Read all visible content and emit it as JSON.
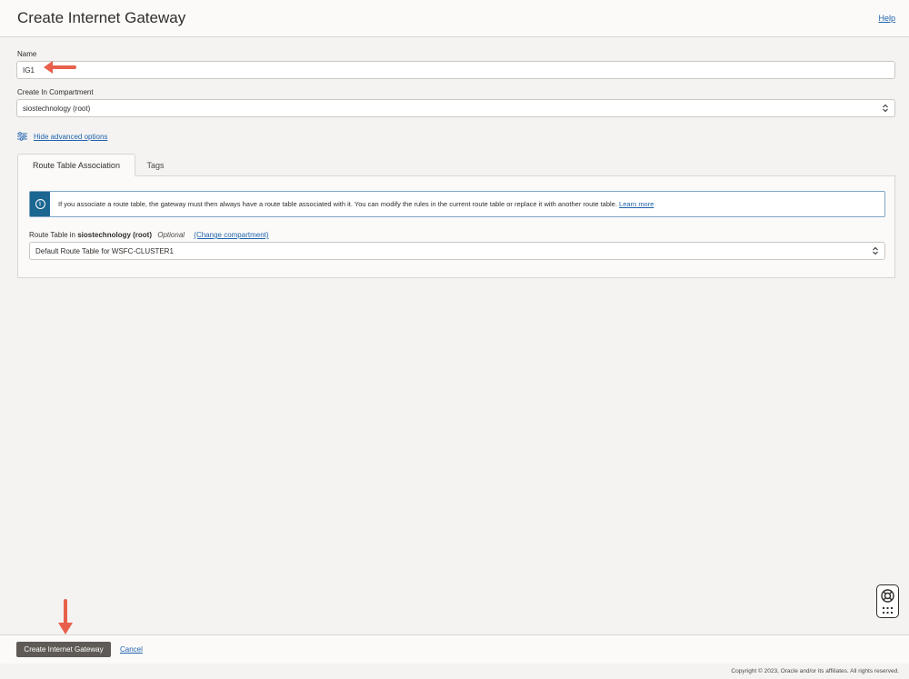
{
  "header": {
    "title": "Create Internet Gateway",
    "help_label": "Help"
  },
  "form": {
    "name_label": "Name",
    "name_value": "IG1",
    "compartment_label": "Create In Compartment",
    "compartment_value": "siostechnology (root)",
    "advanced_toggle_label": "Hide advanced options"
  },
  "tabs": [
    {
      "label": "Route Table Association",
      "active": true
    },
    {
      "label": "Tags",
      "active": false
    }
  ],
  "route_table": {
    "info_text": "If you associate a route table, the gateway must then always have a route table associated with it. You can modify the rules in the current route table or replace it with another route table.",
    "info_link": "Learn more",
    "label_prefix": "Route Table in",
    "compartment": "siostechnology (root)",
    "optional": "Optional",
    "change_compartment": "(Change compartment)",
    "selected": "Default Route Table for WSFC-CLUSTER1"
  },
  "footer": {
    "create_button": "Create Internet Gateway",
    "cancel_label": "Cancel",
    "copyright": "Copyright © 2023, Oracle and/or its affiliates. All rights reserved."
  },
  "annotation_color": "#e8604c",
  "icons": [
    "sliders-icon",
    "info-icon",
    "select-arrows-icon",
    "help-lifebuoy-icon",
    "apps-grid-icon",
    "arrow-left-icon",
    "arrow-down-icon"
  ]
}
